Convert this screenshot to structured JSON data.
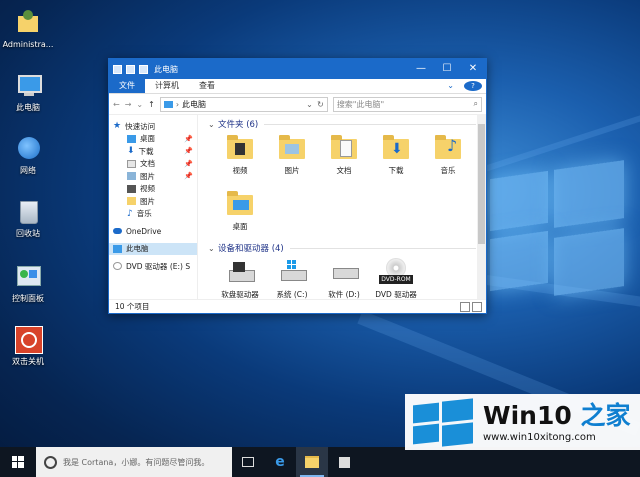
{
  "desktop": {
    "icons": [
      {
        "label": "Administra..."
      },
      {
        "label": "此电脑"
      },
      {
        "label": "网络"
      },
      {
        "label": "回收站"
      },
      {
        "label": "控制面板"
      },
      {
        "label": "双击关机"
      }
    ]
  },
  "explorer": {
    "title": "此电脑",
    "controls": {
      "minimize": "—",
      "maximize": "☐",
      "close": "✕"
    },
    "ribbon": {
      "file": "文件",
      "tabs": [
        "计算机",
        "查看"
      ]
    },
    "address": {
      "path": "此电脑",
      "search_placeholder": "搜索\"此电脑\""
    },
    "nav": [
      {
        "label": "快速访问",
        "level": 0,
        "icon": "star-icon",
        "pinned": false
      },
      {
        "label": "桌面",
        "level": 1,
        "icon": "desktop-icon",
        "pinned": true
      },
      {
        "label": "下载",
        "level": 1,
        "icon": "download-icon",
        "pinned": true
      },
      {
        "label": "文档",
        "level": 1,
        "icon": "document-icon",
        "pinned": true
      },
      {
        "label": "图片",
        "level": 1,
        "icon": "pictures-icon",
        "pinned": true
      },
      {
        "label": "视频",
        "level": 1,
        "icon": "video-icon",
        "pinned": false
      },
      {
        "label": "图片",
        "level": 1,
        "icon": "folder-icon",
        "pinned": false
      },
      {
        "label": "音乐",
        "level": 1,
        "icon": "music-icon",
        "pinned": false
      },
      {
        "label": "OneDrive",
        "level": 0,
        "icon": "cloud-icon",
        "pinned": false
      },
      {
        "label": "此电脑",
        "level": 0,
        "icon": "computer-icon",
        "pinned": false,
        "selected": true
      },
      {
        "label": "DVD 驱动器 (E:) S",
        "level": 0,
        "icon": "dvd-icon",
        "pinned": false
      }
    ],
    "groups": {
      "folders": {
        "title": "文件夹 (6)",
        "items": [
          {
            "label": "视频",
            "icon": "video-folder-icon"
          },
          {
            "label": "图片",
            "icon": "pictures-folder-icon"
          },
          {
            "label": "文档",
            "icon": "documents-folder-icon"
          },
          {
            "label": "下载",
            "icon": "downloads-folder-icon"
          },
          {
            "label": "音乐",
            "icon": "music-folder-icon"
          },
          {
            "label": "桌面",
            "icon": "desktop-folder-icon"
          }
        ]
      },
      "drives": {
        "title": "设备和驱动器 (4)",
        "items": [
          {
            "label": "软盘驱动器 (A:)",
            "icon": "floppy-drive-icon"
          },
          {
            "label": "系统 (C:)",
            "icon": "system-drive-icon"
          },
          {
            "label": "软件 (D:)",
            "icon": "hard-drive-icon"
          },
          {
            "label": "DVD 驱动器 (E:) 爱封",
            "icon": "dvd-drive-icon",
            "badge": "DVD-ROM"
          }
        ]
      }
    },
    "status": {
      "count": "10 个项目"
    }
  },
  "taskbar": {
    "cortana_placeholder": "我是 Cortana，小娜。有问题尽管问我。"
  },
  "watermark": {
    "brand_main": "Win10 ",
    "brand_accent": "之家",
    "url": "www.win10xitong.com"
  },
  "colors": {
    "accent": "#1b6ac9",
    "folder": "#f6d26a",
    "taskbar": "#0e1621"
  }
}
